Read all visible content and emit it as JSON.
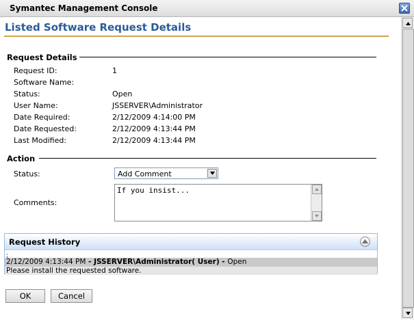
{
  "window": {
    "title": "Symantec Management Console"
  },
  "page": {
    "title": "Listed Software Request Details"
  },
  "request_details": {
    "heading": "Request Details",
    "fields": [
      {
        "label": "Request ID:",
        "value": "1"
      },
      {
        "label": "Software Name:",
        "value": ""
      },
      {
        "label": "Status:",
        "value": "Open"
      },
      {
        "label": "User Name:",
        "value": "JSSERVER\\Administrator"
      },
      {
        "label": "Date Required:",
        "value": "2/12/2009 4:14:00 PM"
      },
      {
        "label": "Date Requested:",
        "value": "2/12/2009 4:13:44 PM"
      },
      {
        "label": "Last Modified:",
        "value": "2/12/2009 4:13:44 PM"
      }
    ]
  },
  "action": {
    "heading": "Action",
    "status_label": "Status:",
    "status_selected": "Add Comment",
    "comments_label": "Comments:",
    "comments_value": "If you insist..."
  },
  "history": {
    "heading": "Request History",
    "entries": [
      {
        "marker": ";",
        "timestamp": "2/12/2009 4:13:44 PM",
        "sep1": " - ",
        "user": "JSSERVER\\Administrator( User)",
        "sep2": " - ",
        "status": "Open",
        "message": "Please install the requested software."
      }
    ]
  },
  "buttons": {
    "ok": "OK",
    "cancel": "Cancel"
  },
  "colors": {
    "title_blue": "#2a5b9a",
    "title_rule": "#d0a24c",
    "panel_border": "#9bb7df"
  }
}
